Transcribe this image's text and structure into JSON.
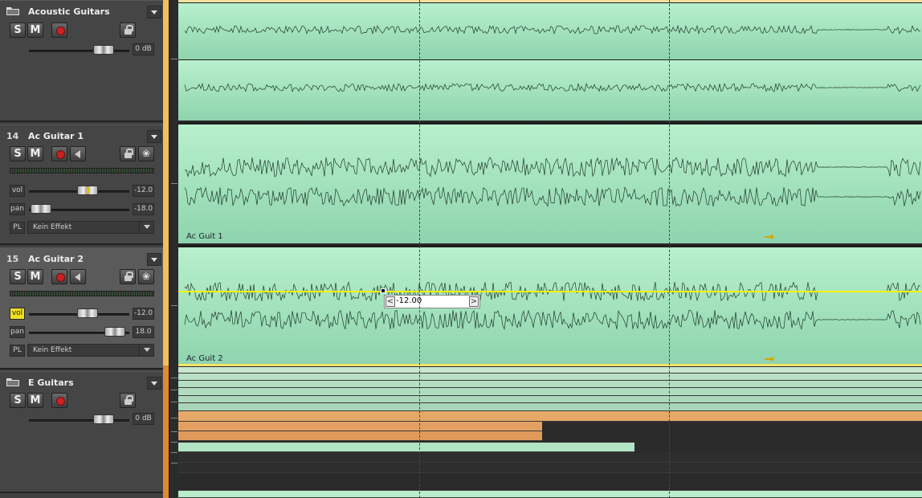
{
  "tracks": [
    {
      "kind": "folder",
      "name": "Acoustic Guitars",
      "solo": "S",
      "mute": "M",
      "volume_value": "0 dB"
    },
    {
      "kind": "audio",
      "number": "14",
      "name": "Ac Guitar 1",
      "solo": "S",
      "mute": "M",
      "vol_label": "vol",
      "vol_value": "-12.0",
      "pan_label": "pan",
      "pan_value": "-18.0",
      "pl_label": "PL",
      "effect": "Kein Effekt"
    },
    {
      "kind": "audio",
      "number": "15",
      "name": "Ac Guitar 2",
      "solo": "S",
      "mute": "M",
      "vol_label": "vol",
      "vol_value": "-12.0",
      "pan_label": "pan",
      "pan_value": "18.0",
      "pl_label": "PL",
      "effect": "Kein Effekt"
    },
    {
      "kind": "folder",
      "name": "E Guitars",
      "solo": "S",
      "mute": "M",
      "volume_value": "0 dB"
    }
  ],
  "clips": {
    "clip1_name": "Ac Guit 1",
    "clip2_name": "Ac Guit 2"
  },
  "tooltip": {
    "value": "-12.00",
    "left": "<",
    "right": ">"
  },
  "colors": {
    "clip_green": "#b8f0cc",
    "automation_yellow": "#f5f000",
    "record_red": "#cc2222",
    "folder_orange": "#e08a30"
  }
}
